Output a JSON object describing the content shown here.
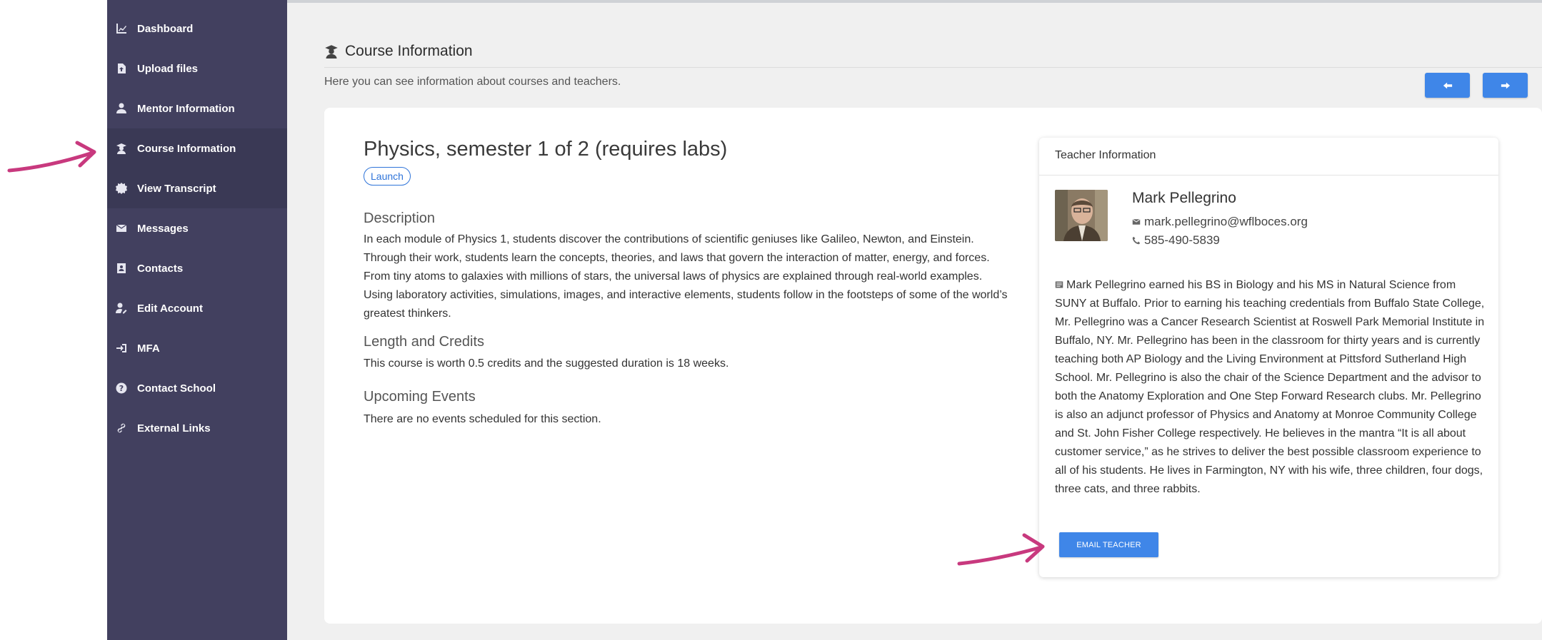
{
  "sidebar": {
    "items": [
      {
        "label": "Dashboard",
        "icon": "chart-icon"
      },
      {
        "label": "Upload files",
        "icon": "file-upload-icon"
      },
      {
        "label": "Mentor Information",
        "icon": "user-tie-icon"
      },
      {
        "label": "Course Information",
        "icon": "graduate-icon",
        "active": true
      },
      {
        "label": "View Transcript",
        "icon": "badge-icon"
      },
      {
        "label": "Messages",
        "icon": "envelope-icon"
      },
      {
        "label": "Contacts",
        "icon": "address-book-icon"
      },
      {
        "label": "Edit Account",
        "icon": "user-edit-icon"
      },
      {
        "label": "MFA",
        "icon": "sign-in-icon"
      },
      {
        "label": "Contact School",
        "icon": "question-circle-icon"
      },
      {
        "label": "External Links",
        "icon": "link-icon"
      }
    ]
  },
  "header": {
    "title": "Course Information",
    "subtitle": "Here you can see information about courses and teachers."
  },
  "course": {
    "title": "Physics, semester 1 of 2 (requires labs)",
    "launch_label": "Launch",
    "description_heading": "Description",
    "description": "In each module of Physics 1, students discover the contributions of scientific geniuses like Galileo, Newton, and Einstein. Through their work, students learn the concepts, theories, and laws that govern the interaction of matter, energy, and forces. From tiny atoms to galaxies with millions of stars, the universal laws of physics are explained through real-world examples. Using laboratory activities, simulations, images, and interactive elements, students follow in the footsteps of some of the world’s greatest thinkers.",
    "length_heading": "Length and Credits",
    "length_text": "This course is worth 0.5 credits and the suggested duration is 18 weeks.",
    "events_heading": "Upcoming Events",
    "events_text": "There are no events scheduled for this section."
  },
  "teacher": {
    "card_title": "Teacher Information",
    "name": "Mark Pellegrino",
    "email": "mark.pellegrino@wflboces.org",
    "phone": "585-490-5839",
    "bio": "Mark Pellegrino earned his BS in Biology and his MS in Natural Science from SUNY at Buffalo. Prior to earning his teaching credentials from Buffalo State College, Mr. Pellegrino was a Cancer Research Scientist at Roswell Park Memorial Institute in Buffalo, NY. Mr. Pellegrino has been in the classroom for thirty years and is currently teaching both AP Biology and the Living Environment at Pittsford Sutherland High School. Mr. Pellegrino is also the chair of the Science Department and the advisor to both the Anatomy Exploration and One Step Forward Research clubs. Mr. Pellegrino is also an adjunct professor of Physics and Anatomy at Monroe Community College and St. John Fisher College respectively. He believes in the mantra “It is all about customer service,” as he strives to deliver the best possible classroom experience to all of his students. He lives in Farmington, NY with his wife, three children, four dogs, three cats, and three rabbits.",
    "email_button": "EMAIL TEACHER"
  },
  "colors": {
    "sidebar_bg": "#42405f",
    "accent": "#3f86e8",
    "annotation_arrow": "#c8397e"
  }
}
